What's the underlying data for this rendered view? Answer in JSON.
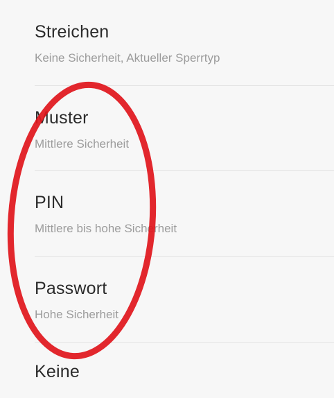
{
  "lock_types": [
    {
      "title": "Streichen",
      "subtitle": "Keine Sicherheit, Aktueller Sperrtyp"
    },
    {
      "title": "Muster",
      "subtitle": "Mittlere Sicherheit"
    },
    {
      "title": "PIN",
      "subtitle": "Mittlere bis hohe Sicherheit"
    },
    {
      "title": "Passwort",
      "subtitle": "Hohe Sicherheit"
    },
    {
      "title": "Keine"
    }
  ],
  "annotation": {
    "color": "#e0151b"
  }
}
